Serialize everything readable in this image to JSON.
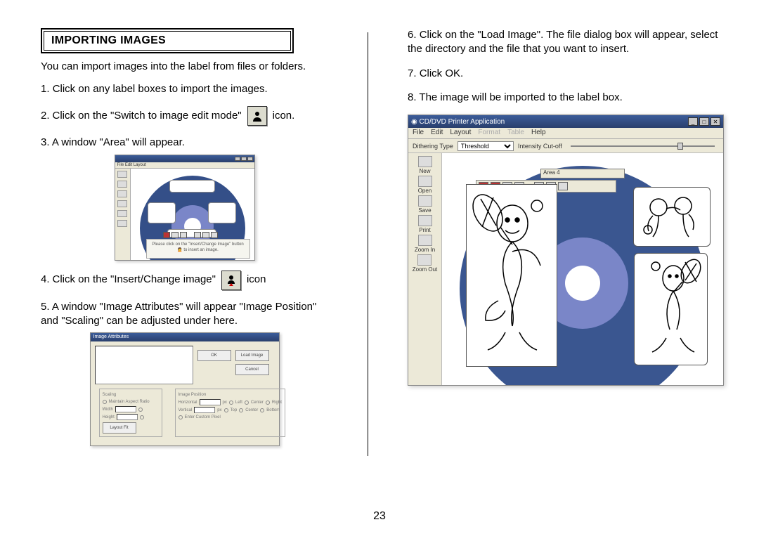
{
  "heading": "IMPORTING IMAGES",
  "intro": "You can import  images into the label from files or  folders.",
  "steps_col1": [
    {
      "num": "1.",
      "text": "Click on any label boxes to import the images."
    },
    {
      "num": "2.",
      "pre": "Click on the \"Switch to image edit  mode\"",
      "post": "icon.",
      "icon": "person-silhouette-icon"
    },
    {
      "num": "3.",
      "text": "A window  \"Area\" will appear."
    },
    {
      "num": "4.",
      "pre": "Click on the \"Insert/Change  image\"",
      "post": "icon",
      "icon": "person-red-arrow-icon"
    },
    {
      "num": "5.",
      "text": " A window  \"Image Attributes\" will appear  \"Image Position\" and \"Scaling\" can be adjusted under here."
    }
  ],
  "steps_col2": [
    {
      "num": "6.",
      "text": "Click on the \"Load Image\".  The file dialog box will appear, select the directory and the file that you want  to insert."
    },
    {
      "num": "7.",
      "text": "Click OK."
    },
    {
      "num": "8.",
      "text": "The image will be imported to the label box."
    }
  ],
  "fig1": {
    "prompt": "Please click on the \"Insert/Change Image\" button  🙍  to insert an image."
  },
  "fig2": {
    "title": "Image Attributes",
    "btn_ok": "OK",
    "btn_load": "Load Image",
    "btn_cancel": "Cancel",
    "grp_scaling": "Scaling",
    "grp_pos": "Image Position",
    "maintain": "Maintain Aspect Ratio",
    "width": "Width",
    "height": "Height",
    "layout": "Layout Fit",
    "horiz": "Horizontal",
    "vert": "Vertical",
    "px": "px",
    "r_left": "Left",
    "r_center": "Center",
    "r_right": "Right",
    "r_top": "Top",
    "r_mid": "Center",
    "r_bot": "Bottom",
    "r_enter": "Enter Custom Pixel"
  },
  "app": {
    "title": "CD/DVD Printer Application",
    "menu": [
      "File",
      "Edit",
      "Layout",
      "Format",
      "Table",
      "Help"
    ],
    "menu_dim": [
      3,
      4
    ],
    "dither_label": "Dithering Type",
    "dither_value": "Threshold",
    "intensity_label": "Intensity Cut-off",
    "side": [
      "New",
      "Open",
      "Save",
      "Print",
      "Zoom In",
      "Zoom Out"
    ],
    "area_label": "Area 4"
  },
  "page_number": "23"
}
